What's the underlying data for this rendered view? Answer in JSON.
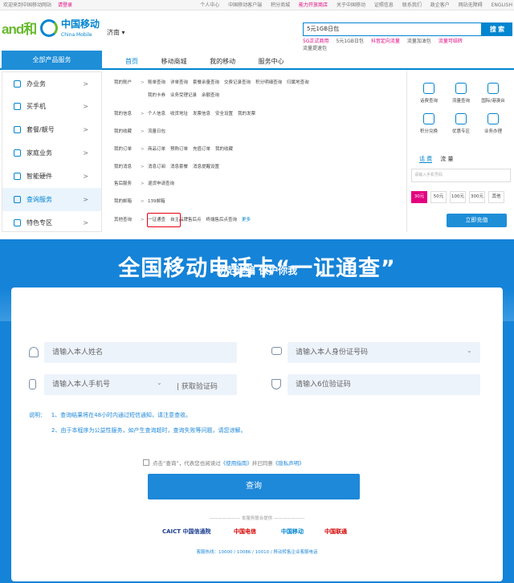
{
  "topbar": {
    "welcome": "欢迎来到中国移动网站",
    "login": "请登录",
    "links": [
      "个人中心",
      "中国移动客户端",
      "积分商城",
      "能力开放商店",
      "关于中国移动",
      "证照信息",
      "联系我们",
      "政企客户",
      "网站无障碍",
      "ENGLISH"
    ]
  },
  "header": {
    "logo_and": "and和",
    "logo_cn": "中国移动",
    "logo_en": "China Mobile",
    "city": "济南",
    "search_value": "5元1GB日包",
    "search_button": "搜 索",
    "hot_row1": [
      "5G正式商用",
      "5元1GB日包",
      "抖音定向流量",
      "流量加油包",
      "流量可结转"
    ],
    "hot_row2": [
      "流量提速包"
    ]
  },
  "nav": {
    "all_products": "全部产品服务",
    "tabs": [
      "首页",
      "移动商城",
      "我的移动",
      "服务中心"
    ]
  },
  "sidebar": {
    "items": [
      {
        "label": "办业务",
        "icon": "briefcase-icon"
      },
      {
        "label": "买手机",
        "icon": "phone-icon"
      },
      {
        "label": "套餐/靓号",
        "icon": "card-icon"
      },
      {
        "label": "家庭业务",
        "icon": "home-icon"
      },
      {
        "label": "智能硬件",
        "icon": "device-icon"
      },
      {
        "label": "查询服务",
        "icon": "user-icon"
      },
      {
        "label": "特色专区",
        "icon": "star-icon"
      }
    ],
    "arrow": ">"
  },
  "menu": {
    "rows": [
      {
        "cat": "我的账户",
        "links": [
          "账单查询",
          "详单查询",
          "套餐余量查询",
          "交费记录查询",
          "积分明细查询",
          "归属地查询"
        ]
      },
      {
        "cat": "",
        "links": [
          "我的卡券",
          "业务受理记录",
          "余额查询"
        ]
      },
      {
        "cat": "我的信息",
        "links": [
          "个人信息",
          "收货地址",
          "发票信息",
          "安全设置",
          "我的发票"
        ]
      },
      {
        "cat": "我的收藏",
        "links": [
          "流量日包"
        ]
      },
      {
        "cat": "我的订单",
        "links": [
          "商品订单",
          "预购订单",
          "充值订单",
          "我的收藏"
        ]
      },
      {
        "cat": "我的消息",
        "links": [
          "消息订阅",
          "消息套餐",
          "消息提醒设置"
        ]
      },
      {
        "cat": "售后服务",
        "links": [
          "退货申请查询"
        ]
      },
      {
        "cat": "我的邮箱",
        "links": [
          "139邮箱"
        ]
      },
      {
        "cat": "其他查询",
        "links": [
          "一证通查",
          "自主品牌售后点",
          "终端售后点查询"
        ],
        "more": "更多"
      }
    ],
    "gt": ">"
  },
  "right_panel": {
    "quick": [
      "话费查询",
      "流量查询",
      "国际/港澳台",
      "积分兑换",
      "优惠专区",
      "业务办理"
    ],
    "tabs": [
      "话 费",
      "流 量"
    ],
    "input_placeholder": "请输入手机号码",
    "amounts": [
      "30元",
      "50元",
      "100元",
      "300元",
      "其他"
    ],
    "recharge": "立即充值"
  },
  "banner": {
    "title": "全国移动电话卡“一证通查”",
    "subtitle": "防范诈骗 保护你我"
  },
  "form": {
    "name_placeholder": "请输入本人姓名",
    "id_placeholder": "请输入本人身份证号码",
    "phone_placeholder": "请输入本人手机号",
    "get_code": "获取验证码",
    "code_placeholder": "请输入6位验证码",
    "note_label": "说明：",
    "note1": "1、查询结果将在48小时内通过短信通知，请注意查收。",
    "note2": "2、由于本程序为公益性服务，如产生查询超时，查询失败等问题，请您谅解。",
    "agree_prefix": "点击“查询”，代表您也阅读过",
    "agree_link1": "《使用指南》",
    "agree_mid": "并已同意",
    "agree_link2": "《隐私声明》",
    "submit": "查询",
    "partners_title": "本服务联合提供",
    "partners": [
      "CAICT 中国信通院",
      "中国电信",
      "中国移动",
      "中国联通"
    ],
    "hotline": "客服热线：10000 / 10086 / 10010 / 移动转售企业客服电话"
  }
}
